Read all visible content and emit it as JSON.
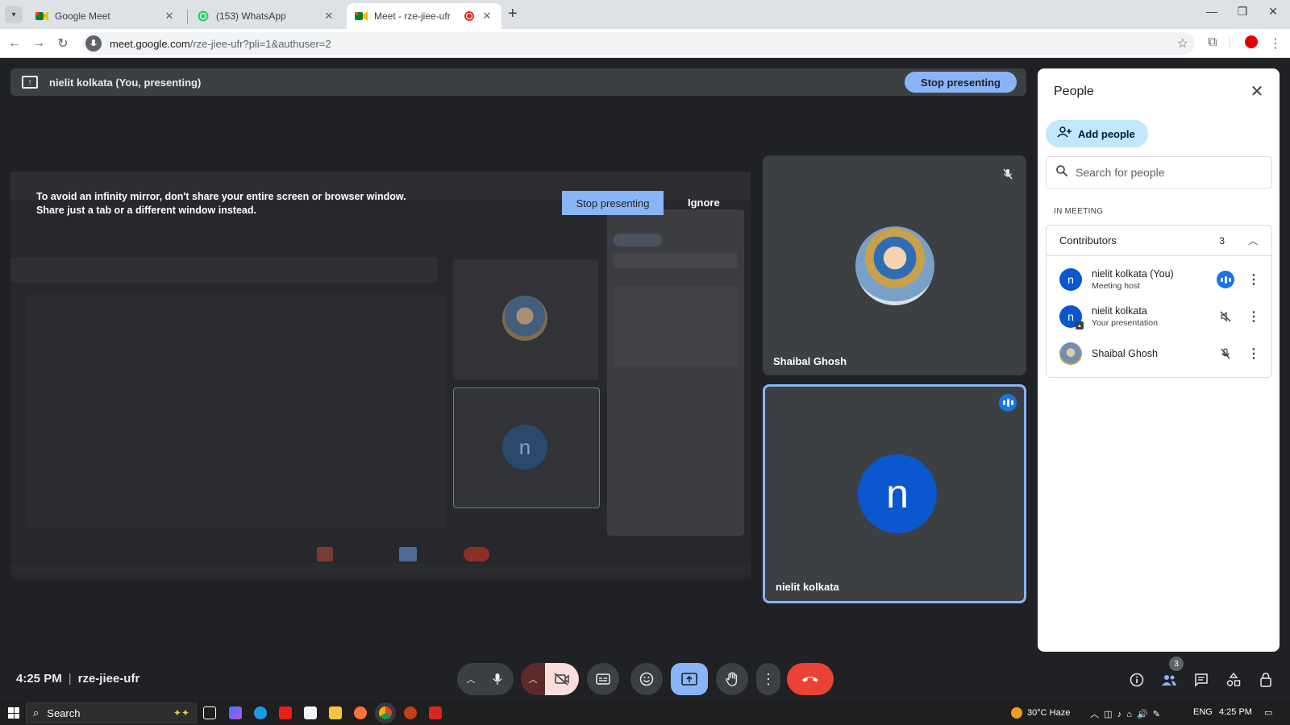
{
  "browser": {
    "tabs": [
      {
        "title": "Google Meet",
        "active": false
      },
      {
        "title": "(153) WhatsApp",
        "active": false
      },
      {
        "title": "Meet - rze-jiee-ufr",
        "active": true
      }
    ],
    "url_host": "meet.google.com",
    "url_path": "/rze-jiee-ufr?pli=1&authuser=2"
  },
  "presenting_bar": {
    "text": "nielit kolkata (You, presenting)",
    "stop_label": "Stop presenting"
  },
  "shared_screen": {
    "warning": "To avoid an infinity mirror, don't share your entire screen or browser window. Share just a tab or a different window instead.",
    "stop_label": "Stop presenting",
    "ignore_label": "Ignore"
  },
  "tiles": [
    {
      "name": "Shaibal Ghosh",
      "muted": true
    },
    {
      "name": "nielit kolkata",
      "initial": "n",
      "speaking": true
    }
  ],
  "people_panel": {
    "title": "People",
    "add_label": "Add people",
    "search_placeholder": "Search for people",
    "section": "IN MEETING",
    "group_label": "Contributors",
    "group_count": "3",
    "people": [
      {
        "name": "nielit kolkata (You)",
        "sub": "Meeting host",
        "initial": "n"
      },
      {
        "name": "nielit kolkata",
        "sub": "Your presentation",
        "initial": "n"
      },
      {
        "name": "Shaibal Ghosh",
        "sub": ""
      }
    ]
  },
  "callbar": {
    "time": "4:25 PM",
    "meeting_code": "rze-jiee-ufr",
    "people_count": "3"
  },
  "taskbar": {
    "search_label": "Search",
    "weather": "30°C  Haze",
    "lang": "ENG",
    "clock": "4:25 PM"
  },
  "colors": {
    "accent": "#8ab4f8",
    "brand_blue": "#0b57d0",
    "end_call": "#ea4335"
  }
}
